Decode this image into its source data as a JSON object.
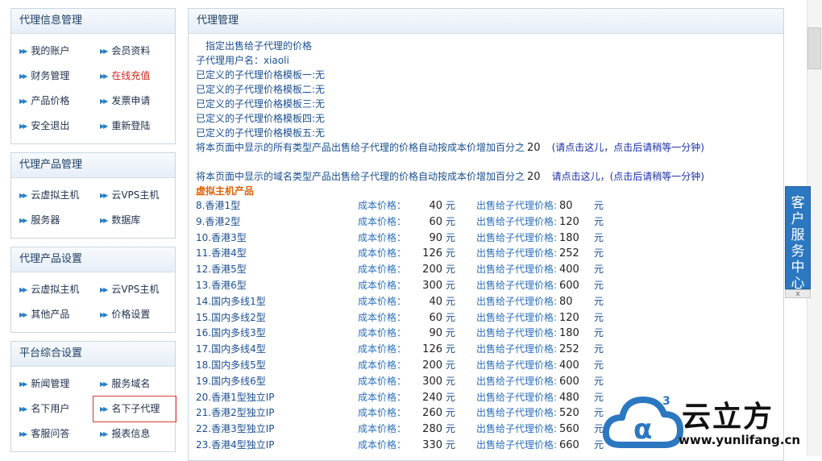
{
  "sidebar": {
    "panels": [
      {
        "title": "代理信息管理",
        "items": [
          "我的账户",
          "会员资料",
          "财务管理",
          "在线充值",
          "产品价格",
          "发票申请",
          "安全退出",
          "重新登陆"
        ]
      },
      {
        "title": "代理产品管理",
        "items": [
          "云虚拟主机",
          "云VPS主机",
          "服务器",
          "数据库"
        ]
      },
      {
        "title": "代理产品设置",
        "items": [
          "云虚拟主机",
          "云VPS主机",
          "其他产品",
          "价格设置"
        ]
      },
      {
        "title": "平台综合设置",
        "items": [
          "新闻管理",
          "服务域名",
          "名下用户",
          "名下子代理",
          "客服问答",
          "报表信息"
        ]
      }
    ],
    "highlight_color": "#d1261e"
  },
  "main": {
    "title": "代理管理",
    "intro": "指定出售给子代理的价格",
    "sub_agent_line": "子代理用户名：xiaoli",
    "templates": [
      "已定义的子代理价格模板一:无",
      "已定义的子代理价格模板二:无",
      "已定义的子代理价格模板三:无",
      "已定义的子代理价格模板四:无",
      "已定义的子代理价格模板五:无"
    ],
    "all_products_text": "将本页面中显示的所有类型产品出售给子代理的价格自动按成本价增加百分之",
    "all_products_pct": "20",
    "all_products_link": "(请点击这儿，点击后请稍等一分钟)",
    "domain_text": "将本页面中显示的域名类型产品出售给子代理的价格自动按成本价增加百分之",
    "domain_pct": "20",
    "domain_link": "请点击这儿，(点击后请稍等一分钟)",
    "section_title": "虚拟主机产品",
    "cost_label": "成本价格：",
    "sell_label": "出售给子代理价格:",
    "unit": "元",
    "products": [
      {
        "name": "8.香港1型",
        "cost": "40",
        "sell": "80"
      },
      {
        "name": "9.香港2型",
        "cost": "60",
        "sell": "120"
      },
      {
        "name": "10.香港3型",
        "cost": "90",
        "sell": "180"
      },
      {
        "name": "11.香港4型",
        "cost": "126",
        "sell": "252"
      },
      {
        "name": "12.香港5型",
        "cost": "200",
        "sell": "400"
      },
      {
        "name": "13.香港6型",
        "cost": "300",
        "sell": "600"
      },
      {
        "name": "14.国内多线1型",
        "cost": "40",
        "sell": "80"
      },
      {
        "name": "15.国内多线2型",
        "cost": "60",
        "sell": "120"
      },
      {
        "name": "16.国内多线3型",
        "cost": "90",
        "sell": "180"
      },
      {
        "name": "17.国内多线4型",
        "cost": "126",
        "sell": "252"
      },
      {
        "name": "18.国内多线5型",
        "cost": "200",
        "sell": "400"
      },
      {
        "name": "19.国内多线6型",
        "cost": "300",
        "sell": "600"
      },
      {
        "name": "20.香港1型独立IP",
        "cost": "240",
        "sell": "480"
      },
      {
        "name": "21.香港2型独立IP",
        "cost": "260",
        "sell": "520"
      },
      {
        "name": "22.香港3型独立IP",
        "cost": "280",
        "sell": "560"
      },
      {
        "name": "23.香港4型独立IP",
        "cost": "330",
        "sell": "660"
      }
    ]
  },
  "service_tab": {
    "label": "客户服务中心",
    "close": "x"
  },
  "watermark": {
    "name": "云立方",
    "url": "www.yunlifang.cn",
    "brand_color": "#2b78c1"
  },
  "icons": {
    "nav_arrow": "double-chevron-right-icon"
  }
}
